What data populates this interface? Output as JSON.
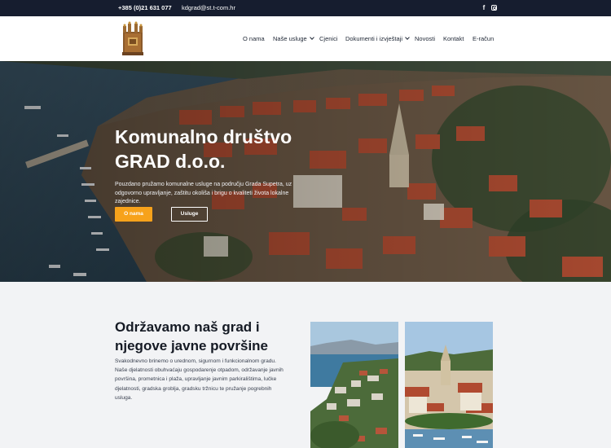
{
  "topbar": {
    "phone": "+385 (0)21 631 077",
    "email": "kdgrad@st.t-com.hr",
    "social": [
      "facebook-icon",
      "instagram-icon"
    ]
  },
  "header": {
    "logo": "company-logo",
    "nav": [
      {
        "label": "O nama",
        "dropdown": false
      },
      {
        "label": "Naše usluge",
        "dropdown": true
      },
      {
        "label": "Cjenici",
        "dropdown": false
      },
      {
        "label": "Dokumenti i izvještaji",
        "dropdown": true
      },
      {
        "label": "Novosti",
        "dropdown": false
      },
      {
        "label": "Kontakt",
        "dropdown": false
      },
      {
        "label": "E-račun",
        "dropdown": false
      }
    ]
  },
  "hero": {
    "title_line1": "Komunalno društvo",
    "title_line2": "GRAD d.o.o.",
    "text": "Pouzdano pružamo komunalne usluge na području Grada Supetra, uz odgovorno upravljanje, zaštitu okoliša i brigu o kvaliteti života lokalne zajednice.",
    "button_primary": "O nama",
    "button_secondary": "Usluge"
  },
  "section": {
    "title": "Održavamo naš grad i njegove javne površine",
    "text": "Svakodnevno brinemo o urednom, sigurnom i funkcionalnom gradu. Naše djelatnosti obuhvaćaju gospodarenje otpadom, održavanje javnih površina, prometnica i plaža, upravljanje javnim parkiralištima, lučke djelatnosti, gradska groblja, gradsku tržnicu te pružanje pogrebnih usluga."
  },
  "colors": {
    "topbar": "#161d2f",
    "accent": "#f7a21b",
    "text_dark": "#151a24",
    "section_bg": "#f2f3f5"
  }
}
